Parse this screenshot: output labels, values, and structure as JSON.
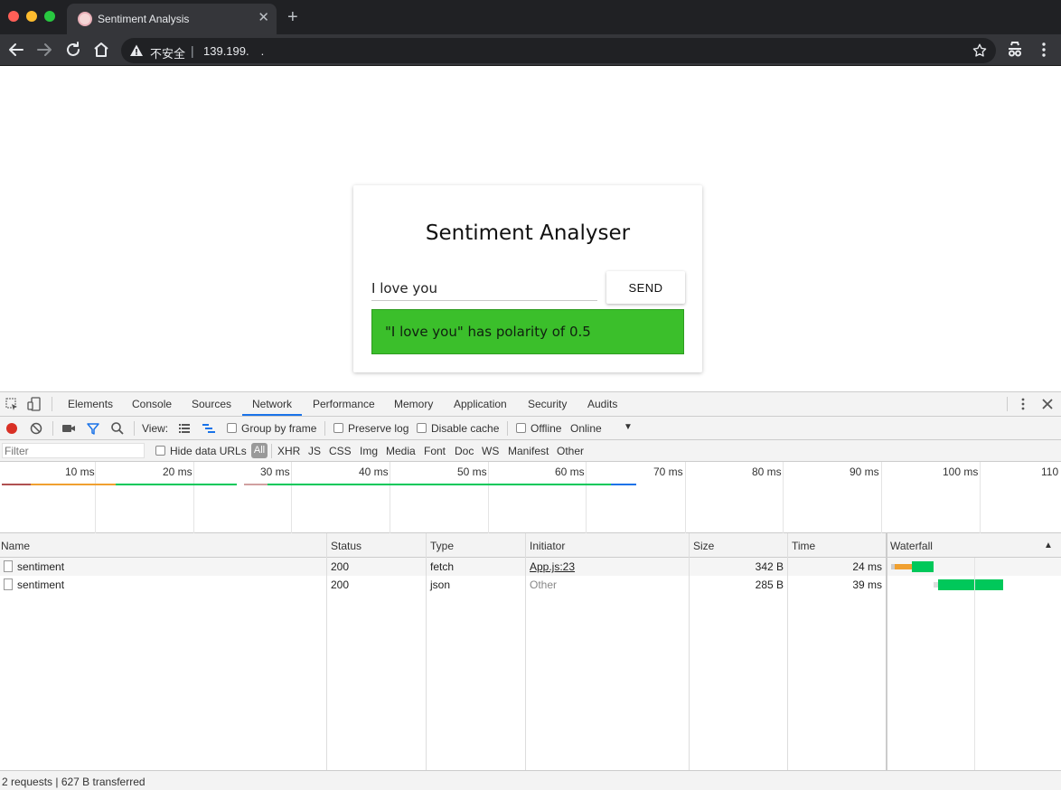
{
  "browser": {
    "tab_title": "Sentiment Analysis",
    "security_label": "不安全",
    "url": "139.199. .  "
  },
  "app": {
    "title": "Sentiment Analyser",
    "input_value": "I love you",
    "send_label": "SEND",
    "result_text": "\"I love you\" has polarity of 0.5",
    "result_color": "#3bbf2b"
  },
  "devtools": {
    "tabs": [
      "Elements",
      "Console",
      "Sources",
      "Network",
      "Performance",
      "Memory",
      "Application",
      "Security",
      "Audits"
    ],
    "active_tab": "Network",
    "view_label": "View:",
    "group_by_frame": "Group by frame",
    "preserve_log": "Preserve log",
    "disable_cache": "Disable cache",
    "offline": "Offline",
    "throttle": "Online",
    "filter_placeholder": "Filter",
    "hide_data_urls": "Hide data URLs",
    "all_label": "All",
    "type_filters": [
      "XHR",
      "JS",
      "CSS",
      "Img",
      "Media",
      "Font",
      "Doc",
      "WS",
      "Manifest",
      "Other"
    ],
    "timeline_labels": [
      "10 ms",
      "20 ms",
      "30 ms",
      "40 ms",
      "50 ms",
      "60 ms",
      "70 ms",
      "80 ms",
      "90 ms",
      "100 ms",
      "110"
    ],
    "columns": [
      "Name",
      "Status",
      "Type",
      "Initiator",
      "Size",
      "Time",
      "Waterfall"
    ],
    "rows": [
      {
        "name": "sentiment",
        "status": "200",
        "type": "fetch",
        "initiator": "App.js:23",
        "size": "342 B",
        "time": "24 ms"
      },
      {
        "name": "sentiment",
        "status": "200",
        "type": "json",
        "initiator": "Other",
        "size": "285 B",
        "time": "39 ms"
      }
    ],
    "summary": "2 requests | 627 B transferred",
    "colors": {
      "accent": "#1a73e8",
      "record": "#d93025",
      "waiting": "#f0a030",
      "download": "#00c85a"
    }
  }
}
